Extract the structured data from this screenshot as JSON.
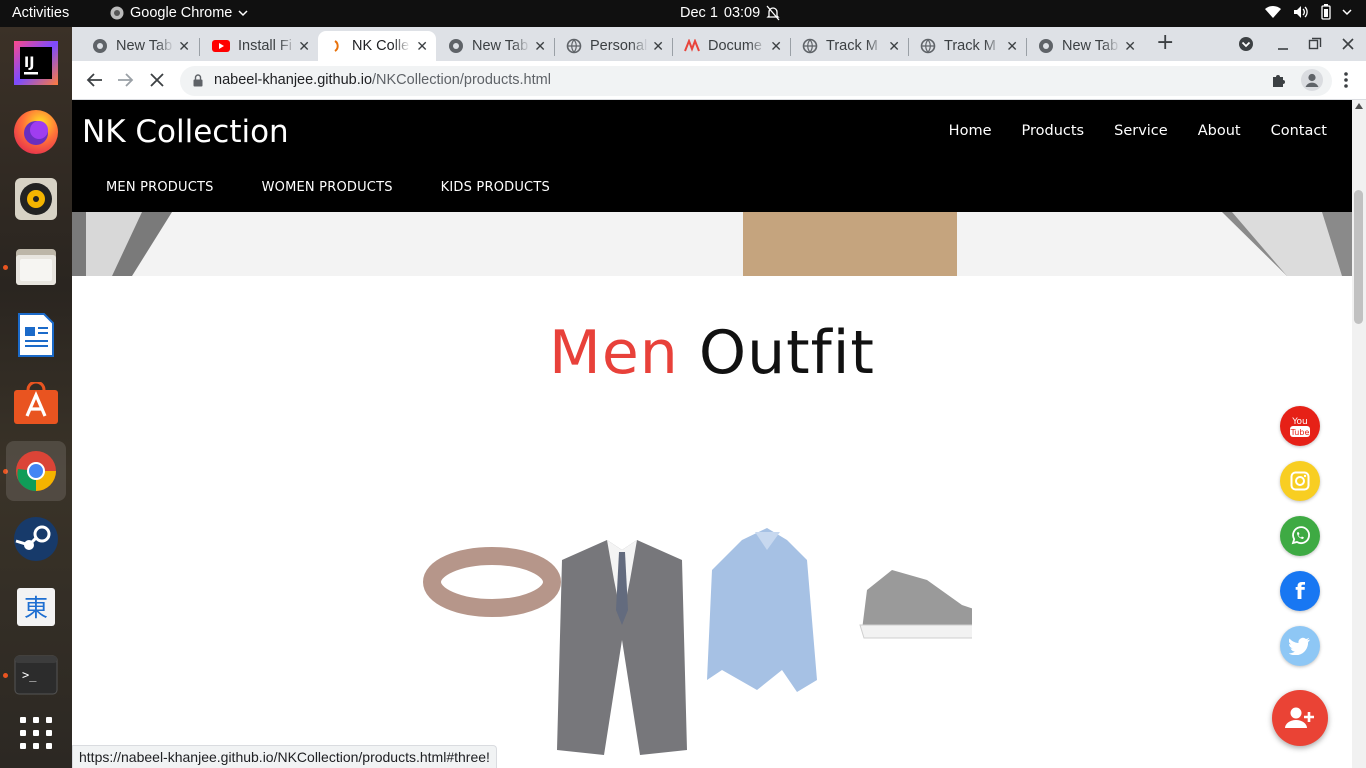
{
  "system": {
    "activities_label": "Activities",
    "app_name": "Google Chrome",
    "date": "Dec 1",
    "time": "03:09"
  },
  "dock": {
    "items": [
      {
        "name": "IntelliJ IDEA",
        "icon": "intellij-icon"
      },
      {
        "name": "Firefox",
        "icon": "firefox-icon"
      },
      {
        "name": "Rhythmbox",
        "icon": "rhythmbox-icon"
      },
      {
        "name": "Files",
        "icon": "files-icon"
      },
      {
        "name": "LibreOffice Writer",
        "icon": "writer-icon"
      },
      {
        "name": "Ubuntu Software",
        "icon": "software-icon"
      },
      {
        "name": "Google Chrome",
        "icon": "chrome-icon"
      },
      {
        "name": "Steam",
        "icon": "steam-icon"
      },
      {
        "name": "Input Method",
        "icon": "input-method-icon",
        "glyph": "東"
      },
      {
        "name": "Terminal",
        "icon": "terminal-icon",
        "glyph": ">_"
      }
    ]
  },
  "browser": {
    "tabs": [
      {
        "title": "New Tab",
        "icon": "chrome-icon"
      },
      {
        "title": "Install Fi",
        "icon": "youtube-icon"
      },
      {
        "title": "NK Colle",
        "icon": "loading-icon",
        "active": true
      },
      {
        "title": "New Tab",
        "icon": "chrome-icon"
      },
      {
        "title": "Personal",
        "icon": "globe-icon"
      },
      {
        "title": "Docume",
        "icon": "doc-icon"
      },
      {
        "title": "Track M",
        "icon": "globe-icon"
      },
      {
        "title": "Track M",
        "icon": "globe-icon"
      },
      {
        "title": "New Tab",
        "icon": "chrome-icon"
      }
    ],
    "new_tab_glyph": "+",
    "url_host": "nabeel-khanjee.github.io",
    "url_path": "/NKCollection/products.html",
    "status_url": "https://nabeel-khanjee.github.io/NKCollection/products.html#three!"
  },
  "site": {
    "brand": "NK Collection",
    "main_nav": [
      "Home",
      "Products",
      "Service",
      "About",
      "Contact"
    ],
    "sub_nav": [
      "MEN PRODUCTS",
      "WOMEN PRODUCTS",
      "KIDS PRODUCTS"
    ],
    "section_title_first": "Men",
    "section_title_second": "Outfit",
    "social": [
      {
        "name": "youtube",
        "color": "#e62117",
        "label_top": "You",
        "label_bottom": "Tube"
      },
      {
        "name": "instagram",
        "color": "#f8ce22"
      },
      {
        "name": "whatsapp",
        "color": "#3eaa43"
      },
      {
        "name": "facebook",
        "color": "#1877f2",
        "glyph": "f"
      },
      {
        "name": "twitter",
        "color": "#8ec7f5"
      }
    ],
    "fab_color": "#ea4335"
  }
}
